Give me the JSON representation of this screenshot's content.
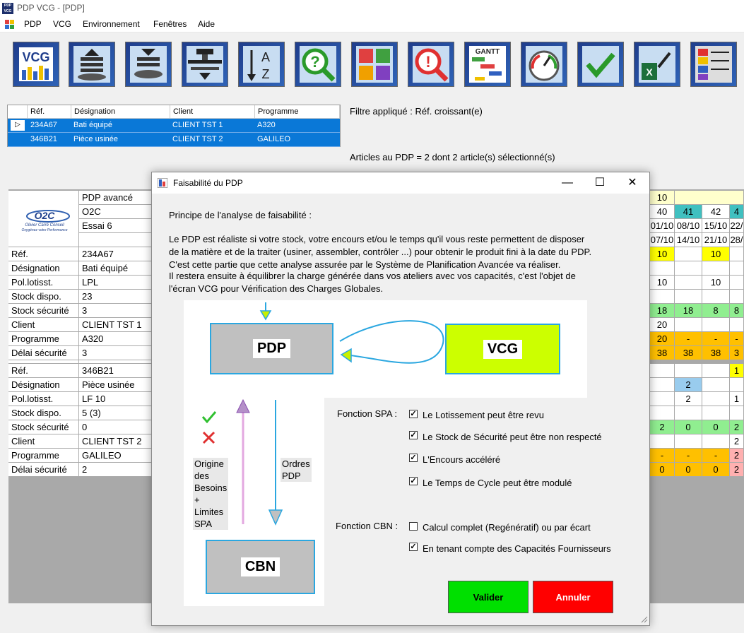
{
  "window": {
    "title": "PDP VCG - [PDP]",
    "icon_text": "PDP\nVCG"
  },
  "menu": [
    "PDP",
    "VCG",
    "Environnement",
    "Fenêtres",
    "Aide"
  ],
  "toolbar": [
    {
      "name": "vcg",
      "label": "VCG"
    },
    {
      "name": "stack-up",
      "label": ""
    },
    {
      "name": "stack-down",
      "label": ""
    },
    {
      "name": "press",
      "label": ""
    },
    {
      "name": "sort",
      "label": "A Z"
    },
    {
      "name": "help",
      "label": "?"
    },
    {
      "name": "puzzle",
      "label": ""
    },
    {
      "name": "alert",
      "label": "!"
    },
    {
      "name": "gantt",
      "label": "GANTT"
    },
    {
      "name": "gauge",
      "label": ""
    },
    {
      "name": "check",
      "label": ""
    },
    {
      "name": "excel",
      "label": ""
    },
    {
      "name": "settings",
      "label": ""
    }
  ],
  "top_grid": {
    "headers": [
      "Réf.",
      "Désignation",
      "Client",
      "Programme"
    ],
    "rows": [
      [
        "234A67",
        "Bati équipé",
        "CLIENT TST 1",
        "A320"
      ],
      [
        "346B21",
        "Pièce usinée",
        "CLIENT TST 2",
        "GALILEO"
      ]
    ]
  },
  "filter_text": "Filtre appliqué : Réf. croissant(e)",
  "count_text": "Articles au PDP = 2 dont 2 article(s) sélectionné(s)",
  "main": {
    "header_label": "PDP avancé",
    "company": "O2C",
    "essai": "Essai  6",
    "logo_text": "O2C",
    "logo_sub": "Olivier Carré Conseil",
    "logo_tag": "Oxygénez votre Performance",
    "article1": [
      [
        "Réf.",
        "234A67"
      ],
      [
        "Désignation",
        "Bati équipé"
      ],
      [
        "Pol.lotisst.",
        "LPL"
      ],
      [
        "Stock dispo.",
        "23"
      ],
      [
        "Stock sécurité",
        "3"
      ],
      [
        "Client",
        "CLIENT TST 1"
      ],
      [
        "Programme",
        "A320"
      ],
      [
        "Délai sécurité",
        "3"
      ]
    ],
    "article2": [
      [
        "Réf.",
        "346B21"
      ],
      [
        "Désignation",
        "Pièce usinée"
      ],
      [
        "Pol.lotisst.",
        "LF 10"
      ],
      [
        "Stock dispo.",
        "5 (3)"
      ],
      [
        "Stock sécurité",
        "0"
      ],
      [
        "Client",
        "CLIENT TST 2"
      ],
      [
        "Programme",
        "GALILEO"
      ],
      [
        "Délai sécurité",
        "2"
      ]
    ],
    "right_cols": {
      "month": "10",
      "weeks": [
        "40",
        "41",
        "42",
        "4"
      ],
      "dates1": [
        "01/10",
        "08/10",
        "15/10",
        "22/"
      ],
      "dates2": [
        "07/10",
        "14/10",
        "21/10",
        "28/"
      ],
      "a1_pdp": [
        "10",
        "",
        "10",
        ""
      ],
      "a1_r2": [
        "10",
        "",
        "10",
        ""
      ],
      "a1_r4": [
        "18",
        "18",
        "8",
        "8"
      ],
      "a1_r5": [
        "20",
        "",
        "",
        ""
      ],
      "a1_r6": [
        "20",
        "-",
        "-",
        "-"
      ],
      "a1_r7": [
        "38",
        "38",
        "38",
        "3"
      ],
      "a2_r0": [
        "",
        "",
        "",
        "1"
      ],
      "a2_r1": [
        "",
        "2",
        "",
        ""
      ],
      "a2_r2": [
        "",
        "2",
        "",
        "1"
      ],
      "a2_r4": [
        "2",
        "0",
        "0",
        "2"
      ],
      "a2_r5": [
        "",
        "",
        "",
        "2"
      ],
      "a2_r6": [
        "-",
        "-",
        "-",
        "2"
      ],
      "a2_r7": [
        "0",
        "0",
        "0",
        "2"
      ]
    }
  },
  "dialog": {
    "title": "Faisabilité du PDP",
    "heading": "Principe de l'analyse de faisabilité :",
    "paragraph": [
      "Le PDP est réaliste si votre stock, votre encours et/ou le temps qu'il vous reste permettent de disposer",
      "de la matière et de la traiter (usiner, assembler, contrôler ...) pour obtenir le produit fini à la date du PDP.",
      "C'est cette partie que cette analyse assurée par le Système de Planification Avancée va réaliser.",
      "Il restera ensuite à équilibrer la charge générée dans vos ateliers avec vos capacités, c'est l'objet de",
      "l'écran VCG pour Vérification des Charges Globales."
    ],
    "diagram": {
      "pdp": "PDP",
      "vcg": "VCG",
      "cbn": "CBN",
      "left_label": [
        "Origine",
        "des",
        "Besoins",
        "+",
        "Limites",
        "SPA"
      ],
      "right_label": [
        "Ordres",
        "PDP"
      ]
    },
    "spa_label": "Fonction SPA :",
    "spa_options": [
      {
        "label": "Le Lotissement peut être revu",
        "checked": true
      },
      {
        "label": "Le Stock de Sécurité peut être non respecté",
        "checked": true
      },
      {
        "label": "L'Encours accéléré",
        "checked": true
      },
      {
        "label": "Le Temps de Cycle peut être modulé",
        "checked": true
      }
    ],
    "cbn_label": "Fonction CBN :",
    "cbn_options": [
      {
        "label": "Calcul complet (Regénératif) ou par écart",
        "checked": false
      },
      {
        "label": "En tenant compte des Capacités Fournisseurs",
        "checked": true
      }
    ],
    "validate": "Valider",
    "cancel": "Annuler",
    "colors": {
      "validate": "#00e000",
      "cancel": "#ff0000",
      "vcg": "#ccff00",
      "box_gray": "#c0c0c0"
    }
  }
}
